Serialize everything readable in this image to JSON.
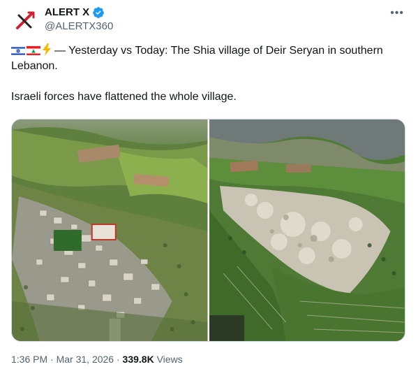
{
  "author": {
    "display_name": "ALERT X",
    "handle": "@ALERTX360",
    "verified": true,
    "avatar_icon": "alert-x-logo-icon"
  },
  "more_icon": "more-horizontal-icon",
  "tweet": {
    "line1": "— Yesterday vs Today: The Shia village of Deir Seryan in southern Lebanon.",
    "line2": "Israeli forces have flattened the whole village.",
    "emoji_icons": [
      "israel-flag-icon",
      "lebanon-flag-icon",
      "lightning-bolt-icon"
    ]
  },
  "media": {
    "images": [
      "village-before-aerial-photo",
      "village-after-aerial-photo"
    ]
  },
  "meta": {
    "time": "1:36 PM",
    "date": "Mar 31, 2026",
    "views_count": "339.8K",
    "views_label": "Views",
    "separator": "·"
  },
  "colors": {
    "text": "#0f1419",
    "secondary": "#536471",
    "verified": "#1d9bf0",
    "logo_red": "#d1202f"
  }
}
